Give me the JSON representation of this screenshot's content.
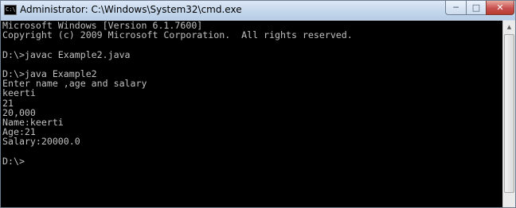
{
  "window": {
    "title": "Administrator: C:\\Windows\\System32\\cmd.exe",
    "icon": "cmd-icon",
    "controls": {
      "minimize": "─",
      "maximize": "□",
      "close": "✕"
    }
  },
  "console": {
    "text_color": "#c0c0c0",
    "background": "#000000",
    "lines": [
      "Microsoft Windows [Version 6.1.7600]",
      "Copyright (c) 2009 Microsoft Corporation.  All rights reserved.",
      "",
      "D:\\>javac Example2.java",
      "",
      "D:\\>java Example2",
      "Enter name ,age and salary",
      "keerti",
      "21",
      "20,000",
      "Name:keerti",
      "Age:21",
      "Salary:20000.0",
      "",
      "D:\\>"
    ]
  },
  "scrollbar": {
    "up_arrow": "▲"
  }
}
